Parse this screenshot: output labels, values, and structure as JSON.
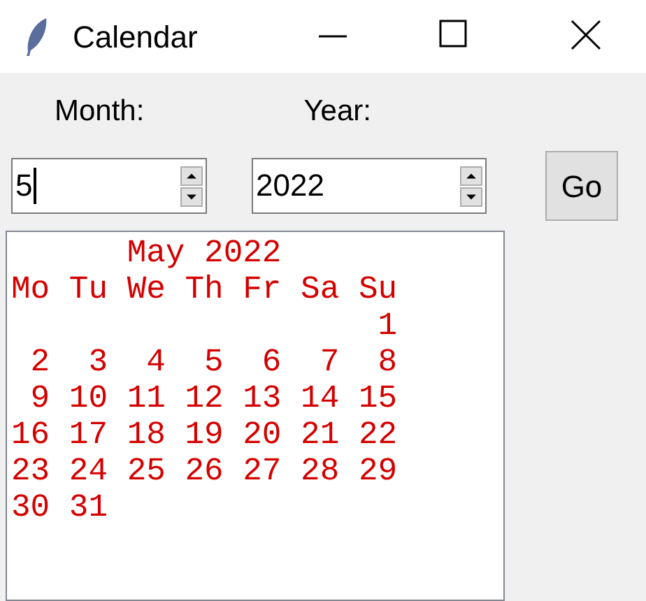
{
  "window": {
    "title": "Calendar"
  },
  "labels": {
    "month": "Month:",
    "year": "Year:"
  },
  "month_field": {
    "value": "5",
    "focused": true
  },
  "year_field": {
    "value": "2022",
    "focused": false
  },
  "go_button": "Go",
  "calendar_text": [
    "      May 2022",
    "Mo Tu We Th Fr Sa Su",
    "                   1",
    " 2  3  4  5  6  7  8",
    " 9 10 11 12 13 14 15",
    "16 17 18 19 20 21 22",
    "23 24 25 26 27 28 29",
    "30 31"
  ]
}
